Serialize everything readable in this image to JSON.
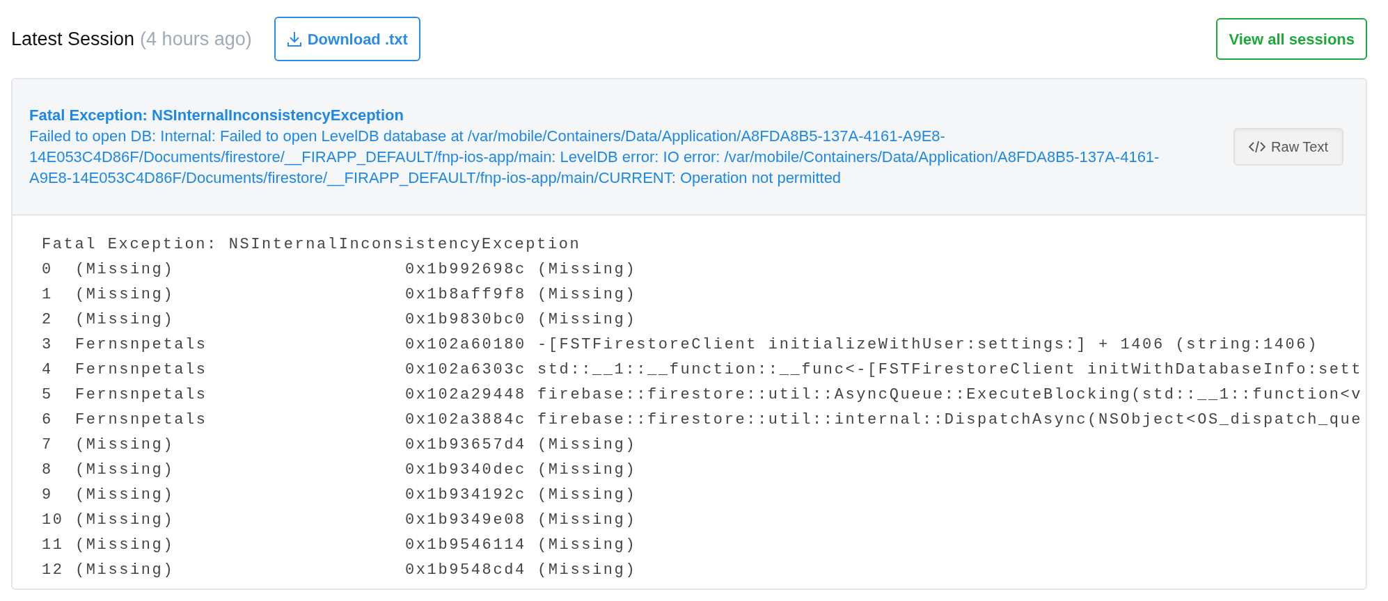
{
  "header": {
    "title": "Latest Session",
    "age": "(4 hours ago)",
    "download_button": "Download .txt",
    "view_all_button": "View all sessions"
  },
  "exception": {
    "title": "Fatal Exception: NSInternalInconsistencyException",
    "message": "Failed to open DB: Internal: Failed to open LevelDB database at /var/mobile/Containers/Data/Application/A8FDA8B5-137A-4161-A9E8-14E053C4D86F/Documents/firestore/__FIRAPP_DEFAULT/fnp-ios-app/main: LevelDB error: IO error: /var/mobile/Containers/Data/Application/A8FDA8B5-137A-4161-A9E8-14E053C4D86F/Documents/firestore/__FIRAPP_DEFAULT/fnp-ios-app/main/CURRENT: Operation not permitted",
    "raw_text_button": "Raw Text"
  },
  "trace": {
    "heading": "Fatal Exception: NSInternalInconsistencyException",
    "frames": [
      {
        "index": "0",
        "module": "(Missing)",
        "address": "0x1b992698c",
        "symbol": "(Missing)"
      },
      {
        "index": "1",
        "module": "(Missing)",
        "address": "0x1b8aff9f8",
        "symbol": "(Missing)"
      },
      {
        "index": "2",
        "module": "(Missing)",
        "address": "0x1b9830bc0",
        "symbol": "(Missing)"
      },
      {
        "index": "3",
        "module": "Fernsnpetals",
        "address": "0x102a60180",
        "symbol": "-[FSTFirestoreClient initializeWithUser:settings:] + 1406 (string:1406)"
      },
      {
        "index": "4",
        "module": "Fernsnpetals",
        "address": "0x102a6303c",
        "symbol": "std::__1::__function::__func<-[FSTFirestoreClient initWithDatabaseInfo:sett"
      },
      {
        "index": "5",
        "module": "Fernsnpetals",
        "address": "0x102a29448",
        "symbol": "firebase::firestore::util::AsyncQueue::ExecuteBlocking(std::__1::function<v"
      },
      {
        "index": "6",
        "module": "Fernsnpetals",
        "address": "0x102a3884c",
        "symbol": "firebase::firestore::util::internal::DispatchAsync(NSObject<OS_dispatch_que"
      },
      {
        "index": "7",
        "module": "(Missing)",
        "address": "0x1b93657d4",
        "symbol": "(Missing)"
      },
      {
        "index": "8",
        "module": "(Missing)",
        "address": "0x1b9340dec",
        "symbol": "(Missing)"
      },
      {
        "index": "9",
        "module": "(Missing)",
        "address": "0x1b934192c",
        "symbol": "(Missing)"
      },
      {
        "index": "10",
        "module": "(Missing)",
        "address": "0x1b9349e08",
        "symbol": "(Missing)"
      },
      {
        "index": "11",
        "module": "(Missing)",
        "address": "0x1b9546114",
        "symbol": "(Missing)"
      },
      {
        "index": "12",
        "module": "(Missing)",
        "address": "0x1b9548cd4",
        "symbol": "(Missing)"
      }
    ]
  }
}
